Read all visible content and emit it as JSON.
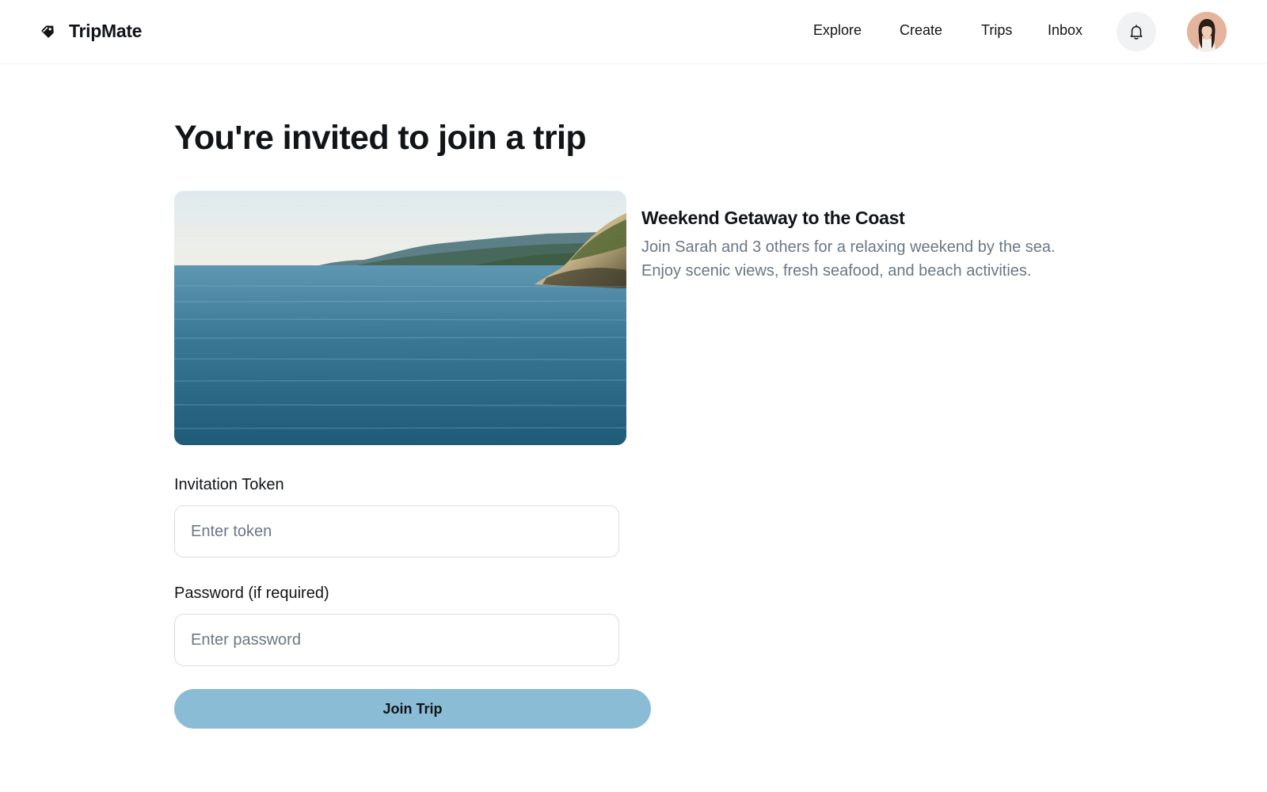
{
  "header": {
    "brand_name": "TripMate",
    "nav": [
      {
        "label": "Explore"
      },
      {
        "label": "Create"
      },
      {
        "label": "Trips"
      },
      {
        "label": "Inbox"
      }
    ],
    "icons": {
      "logo": "tag-logo-icon",
      "notifications": "bell-icon",
      "avatar": "user-avatar"
    }
  },
  "main": {
    "title": "You're invited to join a trip",
    "trip": {
      "title": "Weekend Getaway to the Coast",
      "description": "Join Sarah and 3 others for a relaxing weekend by the sea. Enjoy scenic views, fresh seafood, and beach activities."
    },
    "form": {
      "token_label": "Invitation Token",
      "token_placeholder": "Enter token",
      "token_value": "",
      "password_label": "Password (if required)",
      "password_placeholder": "Enter password",
      "password_value": "",
      "submit_label": "Join Trip"
    }
  },
  "colors": {
    "accent": "#8bbcd6",
    "text": "#111418",
    "muted": "#6b7785",
    "border": "#d9dee3"
  }
}
